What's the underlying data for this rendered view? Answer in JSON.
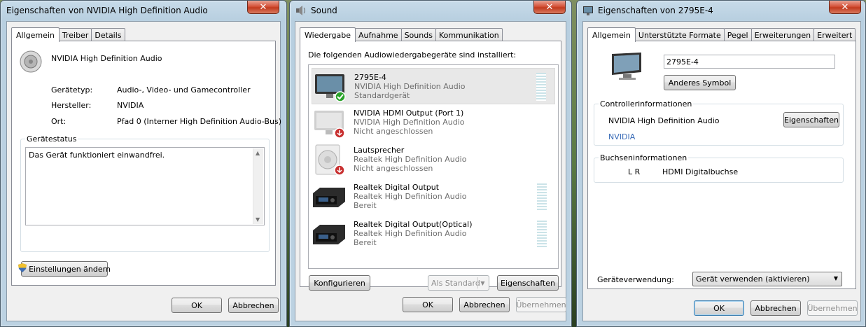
{
  "win1": {
    "title": "Eigenschaften von NVIDIA High Definition Audio",
    "close": "✕",
    "tabs": [
      "Allgemein",
      "Treiber",
      "Details"
    ],
    "device_name": "NVIDIA High Definition Audio",
    "props": [
      {
        "label": "Gerätetyp:",
        "value": "Audio-, Video- und Gamecontroller"
      },
      {
        "label": "Hersteller:",
        "value": "NVIDIA"
      },
      {
        "label": "Ort:",
        "value": "Pfad 0 (Interner High Definition Audio-Bus)"
      }
    ],
    "status_group": "Gerätestatus",
    "status_text": "Das Gerät funktioniert einwandfrei.",
    "settings_button": "Einstellungen ändern",
    "ok": "OK",
    "cancel": "Abbrechen"
  },
  "win2": {
    "title": "Sound",
    "close": "✕",
    "tabs": [
      "Wiedergabe",
      "Aufnahme",
      "Sounds",
      "Kommunikation"
    ],
    "intro": "Die folgenden Audiowiedergabegeräte sind installiert:",
    "devices": [
      {
        "name": "2795E-4",
        "driver": "NVIDIA High Definition Audio",
        "status": "Standardgerät"
      },
      {
        "name": "NVIDIA HDMI Output (Port 1)",
        "driver": "NVIDIA High Definition Audio",
        "status": "Nicht angeschlossen"
      },
      {
        "name": "Lautsprecher",
        "driver": "Realtek High Definition Audio",
        "status": "Nicht angeschlossen"
      },
      {
        "name": "Realtek Digital Output",
        "driver": "Realtek High Definition Audio",
        "status": "Bereit"
      },
      {
        "name": "Realtek Digital Output(Optical)",
        "driver": "Realtek High Definition Audio",
        "status": "Bereit"
      }
    ],
    "configure": "Konfigurieren",
    "set_default": "Als Standard",
    "properties": "Eigenschaften",
    "ok": "OK",
    "cancel": "Abbrechen",
    "apply": "Übernehmen"
  },
  "win3": {
    "title": "Eigenschaften von 2795E-4",
    "close": "✕",
    "tabs": [
      "Allgemein",
      "Unterstützte Formate",
      "Pegel",
      "Erweiterungen",
      "Erweitert"
    ],
    "name_value": "2795E-4",
    "change_icon": "Anderes Symbol",
    "controller_group": "Controllerinformationen",
    "controller_name": "NVIDIA High Definition Audio",
    "controller_props": "Eigenschaften",
    "controller_vendor": "NVIDIA",
    "jack_group": "Buchseninformationen",
    "jack_channels": "L R",
    "jack_type": "HDMI Digitalbuchse",
    "usage_label": "Geräteverwendung:",
    "usage_value": "Gerät verwenden (aktivieren)",
    "ok": "OK",
    "cancel": "Abbrechen",
    "apply": "Übernehmen"
  }
}
